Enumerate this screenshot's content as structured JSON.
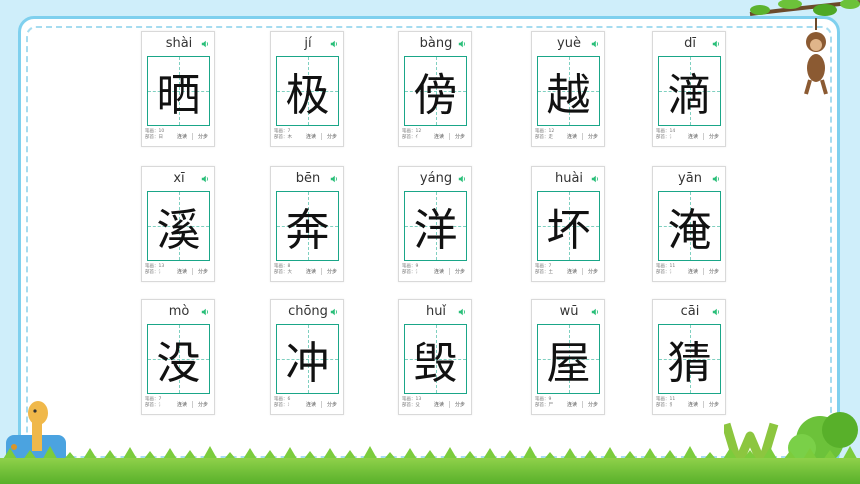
{
  "cards": [
    {
      "pinyin": "shài",
      "char": "晒",
      "strokes": "笔画：10",
      "radical": "部首：日"
    },
    {
      "pinyin": "jí",
      "char": "极",
      "strokes": "笔画：7",
      "radical": "部首：木"
    },
    {
      "pinyin": "bàng",
      "char": "傍",
      "strokes": "笔画：12",
      "radical": "部首：亻"
    },
    {
      "pinyin": "yuè",
      "char": "越",
      "strokes": "笔画：12",
      "radical": "部首：走"
    },
    {
      "pinyin": "dī",
      "char": "滴",
      "strokes": "笔画：14",
      "radical": "部首：氵"
    },
    {
      "pinyin": "xī",
      "char": "溪",
      "strokes": "笔画：13",
      "radical": "部首：氵"
    },
    {
      "pinyin": "bēn",
      "char": "奔",
      "strokes": "笔画：8",
      "radical": "部首：大"
    },
    {
      "pinyin": "yáng",
      "char": "洋",
      "strokes": "笔画：9",
      "radical": "部首：氵"
    },
    {
      "pinyin": "huài",
      "char": "坏",
      "strokes": "笔画：7",
      "radical": "部首：土"
    },
    {
      "pinyin": "yān",
      "char": "淹",
      "strokes": "笔画：11",
      "radical": "部首：氵"
    },
    {
      "pinyin": "mò",
      "char": "没",
      "strokes": "笔画：7",
      "radical": "部首：氵"
    },
    {
      "pinyin": "chōng",
      "char": "冲",
      "strokes": "笔画：6",
      "radical": "部首：冫"
    },
    {
      "pinyin": "huǐ",
      "char": "毁",
      "strokes": "笔画：13",
      "radical": "部首：殳"
    },
    {
      "pinyin": "wū",
      "char": "屋",
      "strokes": "笔画：9",
      "radical": "部首：尸"
    },
    {
      "pinyin": "cāi",
      "char": "猜",
      "strokes": "笔画：11",
      "radical": "部首：犭"
    }
  ],
  "labels": {
    "play": "连读",
    "step": "分步"
  },
  "colors": {
    "grid": "#1aa688",
    "speaker": "#2bbf7a",
    "frame": "#7fd0ee"
  }
}
